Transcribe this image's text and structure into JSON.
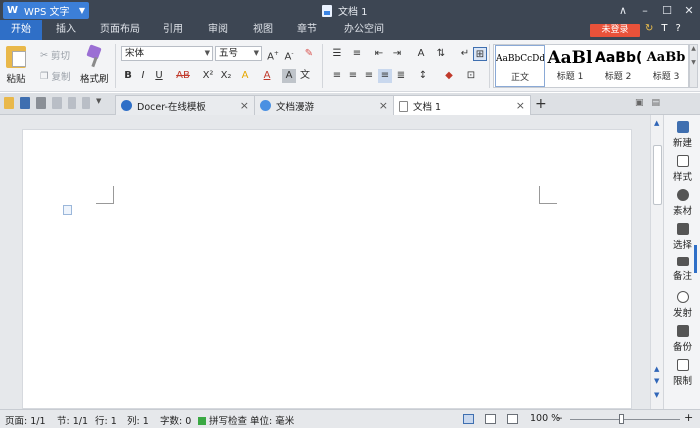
{
  "titlebar": {
    "app_name": "WPS 文字",
    "app_logo": "W",
    "document_title": "文档 1",
    "controls": [
      "∧",
      "–",
      "☐",
      "✕"
    ]
  },
  "menu": {
    "tabs": [
      "开始",
      "插入",
      "页面布局",
      "引用",
      "审阅",
      "视图",
      "章节",
      "办公空间"
    ],
    "active_tab": "开始",
    "login_label": "未登录",
    "right_icons": [
      "↻",
      "T",
      "?"
    ]
  },
  "ribbon": {
    "paste_label": "粘贴",
    "cut_label": "剪切",
    "copy_label": "复制",
    "format_painter_label": "格式刷",
    "font_name": "宋体",
    "font_size": "五号",
    "styles": [
      {
        "sample": "AaBbCcDd",
        "label": "正文"
      },
      {
        "sample": "AaBl",
        "label": "标题 1"
      },
      {
        "sample": "AaBb(",
        "label": "标题 2"
      },
      {
        "sample": "AaBb",
        "label": "标题 3"
      }
    ],
    "format_buttons": [
      "B",
      "I",
      "U",
      "AB",
      "X²",
      "X₂",
      "A",
      "A",
      "A",
      "文"
    ],
    "accent": "#2f6fc7"
  },
  "tabs": [
    {
      "label": "Docer-在线模板",
      "icon_color": "#2f6fc7"
    },
    {
      "label": "文档漫游",
      "icon_color": "#4a90e2"
    },
    {
      "label": "文档 1",
      "icon_color": "#e9ebee"
    }
  ],
  "sidepanel": {
    "items": [
      "新建",
      "样式",
      "素材",
      "选择",
      "备注",
      "发射",
      "备份",
      "限制"
    ]
  },
  "statusbar": {
    "page": "页面: 1/1",
    "section": "节: 1/1",
    "line": "行: 1",
    "column": "列: 1",
    "word_count": "字数: 0",
    "spell_check": "拼写检查",
    "unit": "单位: 毫米",
    "zoom": "100 %",
    "zoom_minus": "–",
    "zoom_plus": "+"
  }
}
